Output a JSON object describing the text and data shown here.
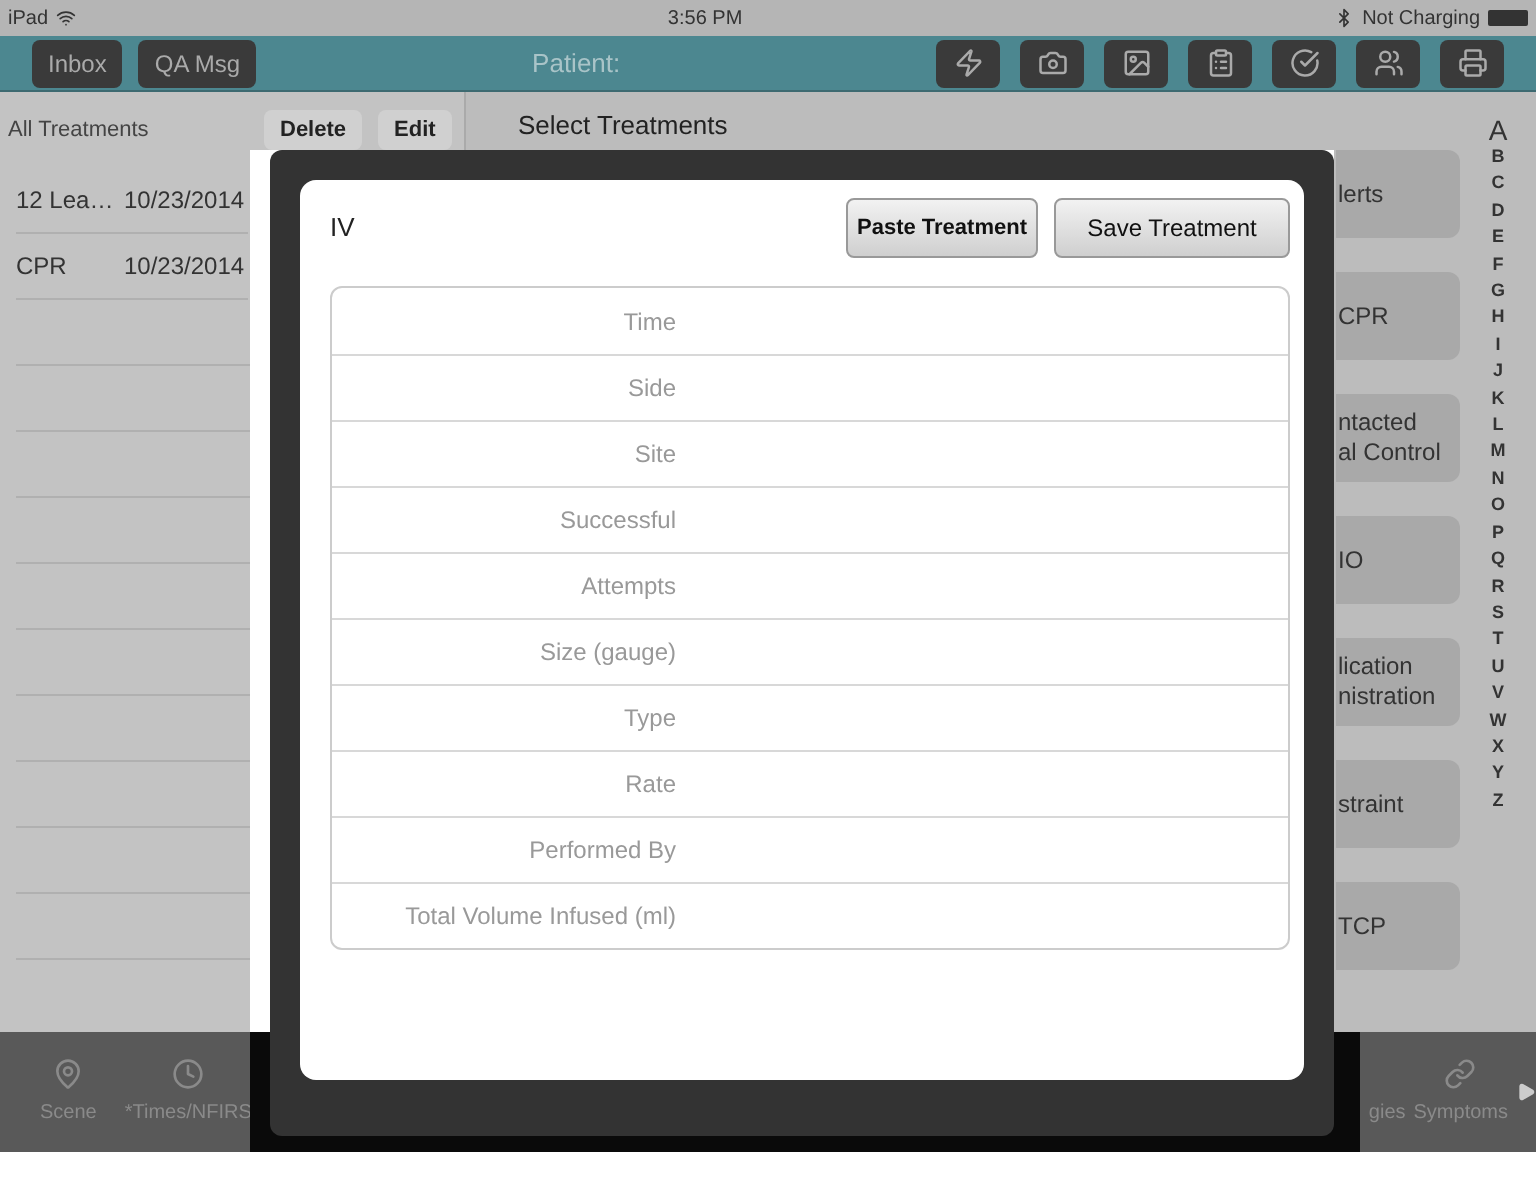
{
  "status_bar": {
    "carrier": "iPad",
    "time": "3:56 PM",
    "battery": "Not Charging"
  },
  "nav": {
    "buttons": [
      "Inbox",
      "QA Msg"
    ],
    "title": "Patient:"
  },
  "left_panel": {
    "title": "All Treatments",
    "buttons": [
      "Delete",
      "Edit"
    ],
    "rows": [
      {
        "name": "12 Lea…",
        "date": "10/23/2014"
      },
      {
        "name": "CPR",
        "date": "10/23/2014"
      }
    ]
  },
  "main": {
    "title": "Select Treatments"
  },
  "treatment_buttons": [
    [
      "lerts"
    ],
    [
      "CPR"
    ],
    [
      "ntacted",
      "al Control"
    ],
    [
      "IO"
    ],
    [
      "lication",
      "nistration"
    ],
    [
      "straint"
    ],
    [
      "TCP"
    ]
  ],
  "index_letters": [
    "A",
    "B",
    "C",
    "D",
    "E",
    "F",
    "G",
    "H",
    "I",
    "J",
    "K",
    "L",
    "M",
    "N",
    "O",
    "P",
    "Q",
    "R",
    "S",
    "T",
    "U",
    "V",
    "W",
    "X",
    "Y",
    "Z"
  ],
  "tab_bar": {
    "left": [
      "Scene",
      "*Times/NFIRS"
    ],
    "right": [
      "gies",
      "Symptoms"
    ]
  },
  "dialog": {
    "title": "IV",
    "buttons": [
      {
        "label": "Paste Treatment",
        "bold": true
      },
      {
        "label": "Save Treatment",
        "bold": false
      }
    ],
    "fields": [
      "Time",
      "Side",
      "Site",
      "Successful",
      "Attempts",
      "Size (gauge)",
      "Type",
      "Rate",
      "Performed By",
      "Total Volume Infused (ml)"
    ]
  }
}
